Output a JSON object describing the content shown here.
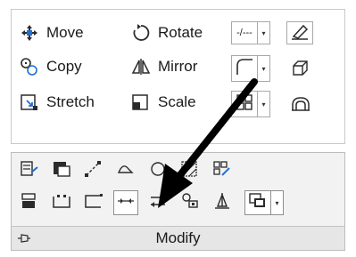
{
  "panel": {
    "title": "Modify"
  },
  "commands": {
    "move": "Move",
    "copy": "Copy",
    "stretch": "Stretch",
    "rotate": "Rotate",
    "mirror": "Mirror",
    "scale": "Scale"
  },
  "dropdowns": {
    "trim_glyph": "-/---",
    "arrow_glyph": "▾"
  },
  "colors": {
    "accent_blue": "#1f6fd0",
    "dark": "#2b2b2b",
    "callout_arrow": "#000000"
  }
}
